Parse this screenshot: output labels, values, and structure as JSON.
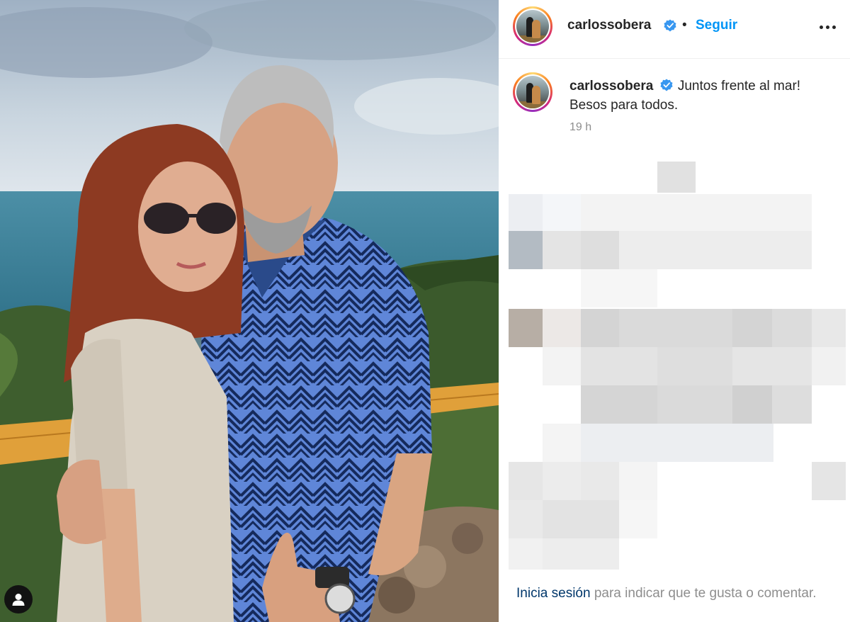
{
  "post": {
    "username": "carlossobera",
    "follow_label": "Seguir",
    "separator": "•",
    "caption_text": "Juntos frente al mar! Besos para todos.",
    "timestamp": "19 h",
    "icons": [
      "verified-badge-icon",
      "more-options-icon",
      "user-tag-icon"
    ]
  },
  "footer": {
    "login_link": "Inicia sesión",
    "login_suffix": "para indicar que te gusta o comentar."
  },
  "colors": {
    "accent": "#0095f6",
    "link_dark": "#00376b",
    "muted": "#8e8e8e",
    "text": "#262626",
    "verified": "#3897f0"
  }
}
